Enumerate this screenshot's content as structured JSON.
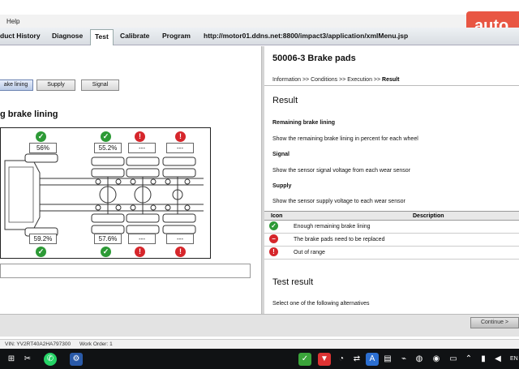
{
  "menu": {
    "help": "Help"
  },
  "tabs": [
    {
      "label": "duct History"
    },
    {
      "label": "Diagnose"
    },
    {
      "label": "Test"
    },
    {
      "label": "Calibrate"
    },
    {
      "label": "Program"
    }
  ],
  "url": "http://motor01.ddns.net:8800/impact3/application/xmlMenu.jsp",
  "watermark": "auto",
  "left": {
    "subtabs": [
      {
        "label": "ake lining"
      },
      {
        "label": "Supply"
      },
      {
        "label": "Signal"
      }
    ],
    "section_title": "g brake lining",
    "wheels": {
      "front_left": {
        "value": "56%",
        "status": "ok"
      },
      "rear1_left": {
        "value": "55.2%",
        "status": "ok"
      },
      "rear2_left": {
        "value": "---",
        "status": "bad"
      },
      "rear3_left": {
        "value": "---",
        "status": "bad"
      },
      "front_right": {
        "value": "59.2%",
        "status": "ok"
      },
      "rear1_right": {
        "value": "57.6%",
        "status": "ok"
      },
      "rear2_right": {
        "value": "---",
        "status": "bad"
      },
      "rear3_right": {
        "value": "---",
        "status": "bad"
      }
    }
  },
  "right": {
    "title": "50006-3 Brake pads",
    "breadcrumb": "Information >> Conditions >> Execution >> ",
    "breadcrumb_current": "Result",
    "result_heading": "Result",
    "items": [
      {
        "heading": "Remaining brake lining",
        "text": "Show the remaining brake lining in percent for each wheel"
      },
      {
        "heading": "Signal",
        "text": "Show the sensor signal voltage from each wear sensor"
      },
      {
        "heading": "Supply",
        "text": "Show the sensor supply voltage to each wear sensor"
      }
    ],
    "legend_headers": {
      "icon": "Icon",
      "description": "Description"
    },
    "legend": [
      {
        "status": "ok",
        "text": "Enough remaining brake lining"
      },
      {
        "status": "stop",
        "text": "The brake pads need to be replaced"
      },
      {
        "status": "bad",
        "text": "Out of range"
      }
    ],
    "test_result_heading": "Test result",
    "select_text": "Select one of the following alternatives"
  },
  "continue_label": "Continue >",
  "status": {
    "vin": "VIN: YV2RT40A2HA797300",
    "work_order": "Work Order: 1"
  },
  "taskbar": {
    "lang": "EN"
  },
  "colors": {
    "ok": "#2d9a36",
    "bad": "#d6262b",
    "accent": "#e84e3a"
  }
}
